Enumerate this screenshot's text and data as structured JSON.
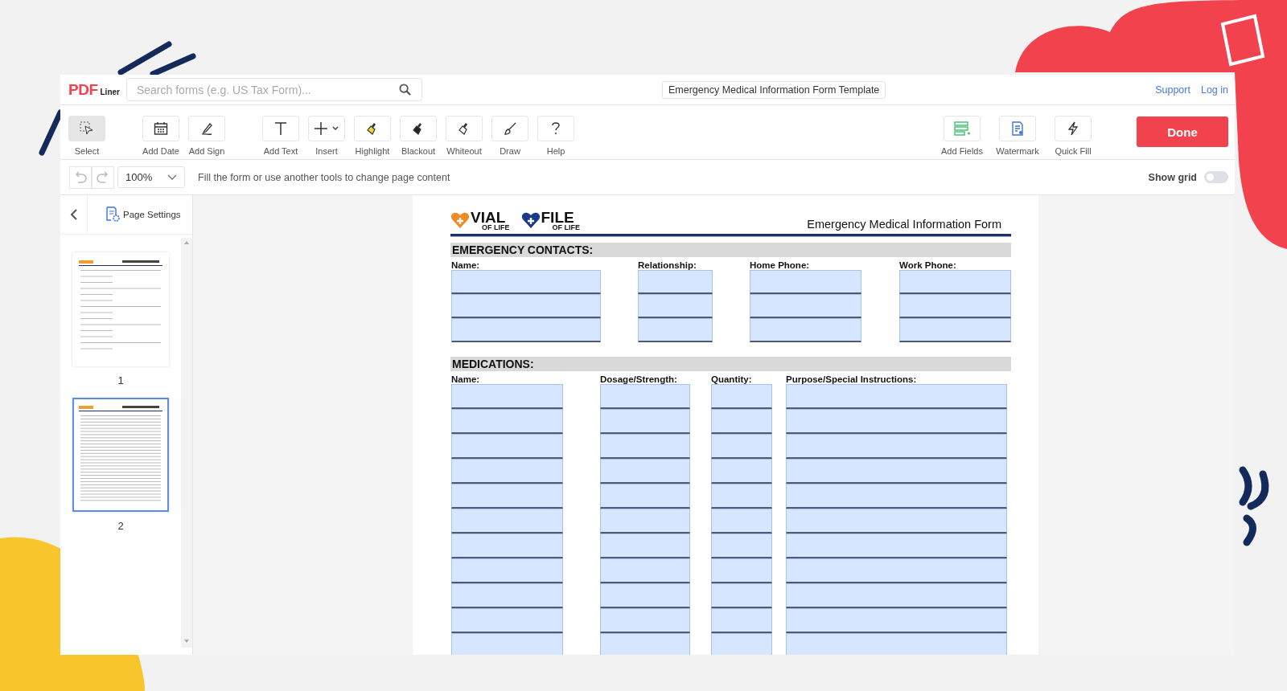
{
  "header": {
    "logo_main": "PDF",
    "logo_sub": "Liner",
    "search": {
      "placeholder": "Search forms (e.g. US Tax Form)..."
    },
    "doc_title": "Emergency Medical Information Form Template",
    "links": [
      "Support",
      "Log in"
    ]
  },
  "toolbar": {
    "tools": [
      {
        "label": "Select",
        "kind": "select",
        "selected": true
      },
      {
        "label": "Add Date",
        "kind": "date",
        "selected": false
      },
      {
        "label": "Add Sign",
        "kind": "sign",
        "selected": false
      },
      {
        "label": "Add Text",
        "kind": "text",
        "selected": false
      },
      {
        "label": "Insert",
        "kind": "insert",
        "selected": false
      },
      {
        "label": "Highlight",
        "kind": "highlight",
        "selected": false
      },
      {
        "label": "Blackout",
        "kind": "blackout",
        "selected": false
      },
      {
        "label": "Whiteout",
        "kind": "whiteout",
        "selected": false
      },
      {
        "label": "Draw",
        "kind": "draw",
        "selected": false
      },
      {
        "label": "Help",
        "kind": "help",
        "selected": false
      }
    ],
    "right_tools": [
      {
        "label": "Add Fields",
        "kind": "fields"
      },
      {
        "label": "Watermark",
        "kind": "watermark"
      },
      {
        "label": "Quick Fill",
        "kind": "quickfill"
      }
    ],
    "done": "Done"
  },
  "subbar": {
    "zoom": "100%",
    "hint": "Fill the form or use another tools to change page content",
    "grid": {
      "label": "Show grid",
      "on": false
    }
  },
  "sidebar": {
    "settings": "Page Settings",
    "pages": [
      {
        "label": "1",
        "selected": false
      },
      {
        "label": "2",
        "selected": true
      }
    ]
  },
  "document": {
    "logo_1": {
      "big": "VIAL",
      "small": "OF LIFE"
    },
    "logo_2": {
      "big": "FILE",
      "small": "OF LIFE"
    },
    "title": "Emergency Medical Information Form",
    "sections": [
      {
        "heading": "EMERGENCY CONTACTS:",
        "columns": [
          "Name:",
          "Relationship:",
          "Home Phone:",
          "Work Phone:"
        ],
        "rows": [
          {
            "kind": "empty"
          },
          {
            "kind": "empty"
          },
          {
            "kind": "empty"
          }
        ]
      },
      {
        "heading": "MEDICATIONS:",
        "columns": [
          "Name:",
          "Dosage/Strength:",
          "Quantity:",
          "Purpose/Special Instructions:"
        ],
        "rows": [
          {
            "kind": "empty"
          },
          {
            "kind": "empty"
          },
          {
            "kind": "empty"
          },
          {
            "kind": "empty"
          },
          {
            "kind": "empty"
          },
          {
            "kind": "empty"
          },
          {
            "kind": "empty"
          },
          {
            "kind": "empty"
          },
          {
            "kind": "empty"
          },
          {
            "kind": "empty"
          },
          {
            "kind": "empty"
          }
        ]
      }
    ]
  }
}
